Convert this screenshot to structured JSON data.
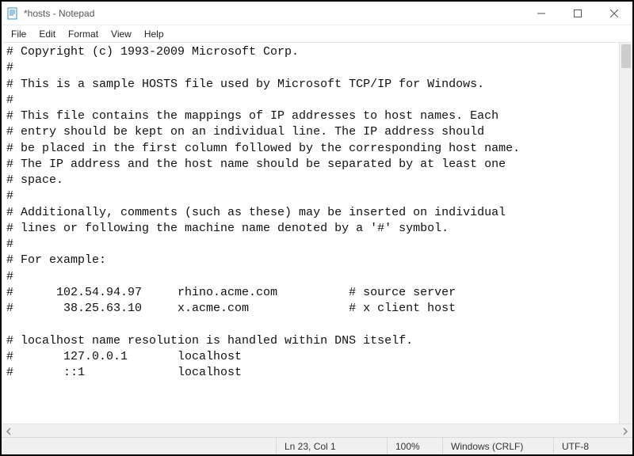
{
  "title": "*hosts - Notepad",
  "menu": {
    "items": [
      "File",
      "Edit",
      "Format",
      "View",
      "Help"
    ]
  },
  "document_text": "# Copyright (c) 1993-2009 Microsoft Corp.\n#\n# This is a sample HOSTS file used by Microsoft TCP/IP for Windows.\n#\n# This file contains the mappings of IP addresses to host names. Each\n# entry should be kept on an individual line. The IP address should\n# be placed in the first column followed by the corresponding host name.\n# The IP address and the host name should be separated by at least one\n# space.\n#\n# Additionally, comments (such as these) may be inserted on individual\n# lines or following the machine name denoted by a '#' symbol.\n#\n# For example:\n#\n#      102.54.94.97     rhino.acme.com          # source server\n#       38.25.63.10     x.acme.com              # x client host\n\n# localhost name resolution is handled within DNS itself.\n#       127.0.0.1       localhost\n#       ::1             localhost",
  "status": {
    "position": "Ln 23, Col 1",
    "zoom": "100%",
    "line_ending": "Windows (CRLF)",
    "encoding": "UTF-8"
  }
}
